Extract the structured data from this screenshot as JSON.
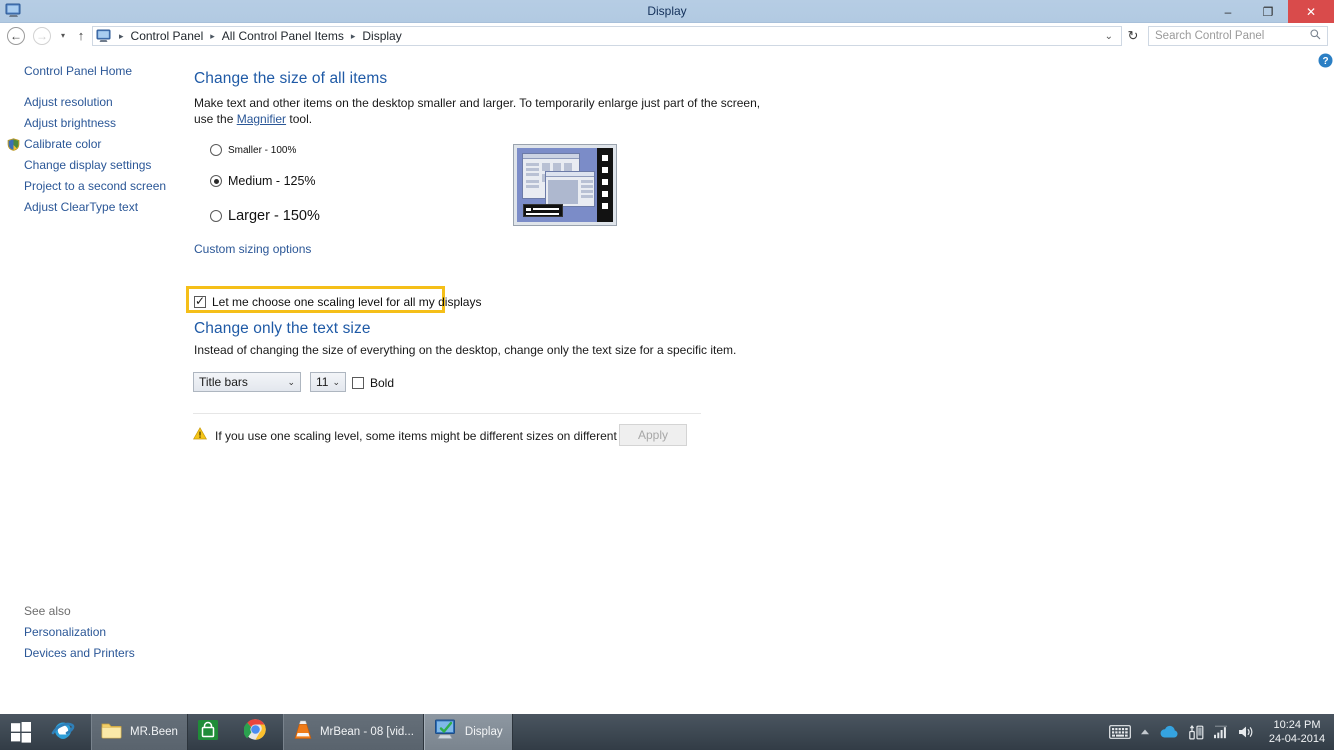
{
  "window": {
    "title": "Display",
    "icon": "display-monitor-icon",
    "minimize_label": "–",
    "maximize_label": "❐",
    "close_label": "✕",
    "titlebar_color": "#b4cbe3",
    "close_color": "#d94b4b"
  },
  "nav": {
    "back_label": "←",
    "forward_label": "→",
    "recent_label": "▾",
    "up_label": "↑",
    "refresh_label": "↻",
    "address_chevron": "⌄",
    "breadcrumbs": [
      "Control Panel",
      "All Control Panel Items",
      "Display"
    ],
    "separator": "▸"
  },
  "search": {
    "placeholder": "Search Control Panel",
    "icon": "search-icon",
    "value": ""
  },
  "sidebar": {
    "home": "Control Panel Home",
    "items": [
      {
        "label": "Adjust resolution",
        "shield": false
      },
      {
        "label": "Adjust brightness",
        "shield": false
      },
      {
        "label": "Calibrate color",
        "shield": true
      },
      {
        "label": "Change display settings",
        "shield": false
      },
      {
        "label": "Project to a second screen",
        "shield": false
      },
      {
        "label": "Adjust ClearType text",
        "shield": false
      }
    ],
    "see_also_title": "See also",
    "see_also": [
      "Personalization",
      "Devices and Printers"
    ]
  },
  "main": {
    "heading1": "Change the size of all items",
    "desc1_part1": "Make text and other items on the desktop smaller and larger. To temporarily enlarge just part of the screen,",
    "desc1_part2_pre": "use the ",
    "desc1_link": "Magnifier",
    "desc1_part2_post": " tool.",
    "scaling_options": [
      {
        "label": "Smaller - 100%",
        "selected": false,
        "font_size": "10px"
      },
      {
        "label": "Medium - 125%",
        "selected": true,
        "font_size": "12.5px"
      },
      {
        "label": "Larger - 150%",
        "selected": false,
        "font_size": "14.5px"
      }
    ],
    "custom_sizing_link": "Custom sizing options",
    "preview_alt": "display-scaling-preview",
    "scaling_checkbox": {
      "label": "Let me choose one scaling level for all my displays",
      "checked": true,
      "highlight_color": "#f5bf18"
    },
    "heading2": "Change only the text size",
    "desc2": "Instead of changing the size of everything on the desktop, change only the text size for a specific item.",
    "item_select": {
      "value": "Title bars",
      "chevron": "⌄"
    },
    "size_select": {
      "value": "11",
      "chevron": "⌄"
    },
    "bold_checkbox": {
      "label": "Bold",
      "checked": false
    },
    "warning_icon": "warning-triangle-icon",
    "warning_text": "If you use one scaling level, some items might be different sizes on different displays.",
    "apply_button": "Apply",
    "apply_enabled": false,
    "help_icon": "help-question-icon"
  },
  "taskbar": {
    "start_label": "start-button",
    "items": [
      {
        "name": "internet-explorer",
        "label": "",
        "icon": "ie-icon",
        "framed": false,
        "active": false
      },
      {
        "name": "file-explorer",
        "label": "MR.Been",
        "icon": "folder-icon",
        "framed": true,
        "active": false
      },
      {
        "name": "windows-store",
        "label": "",
        "icon": "store-icon",
        "framed": false,
        "active": false
      },
      {
        "name": "google-chrome",
        "label": "",
        "icon": "chrome-icon",
        "framed": false,
        "active": false
      },
      {
        "name": "vlc-media-player",
        "label": "MrBean - 08 [vid...",
        "icon": "vlc-cone-icon",
        "framed": true,
        "active": false
      },
      {
        "name": "display-control-panel",
        "label": "Display",
        "icon": "display-monitor-icon",
        "framed": true,
        "active": true
      }
    ],
    "tray": {
      "keyboard_icon": "keyboard-icon",
      "overflow_icon": "show-hidden-icons-icon",
      "onedrive_icon": "onedrive-cloud-icon",
      "action_center_icon": "network-usb-icon",
      "wifi_icon": "wifi-signal-icon",
      "volume_icon": "speaker-icon",
      "time": "10:24 PM",
      "date": "24-04-2014"
    }
  }
}
